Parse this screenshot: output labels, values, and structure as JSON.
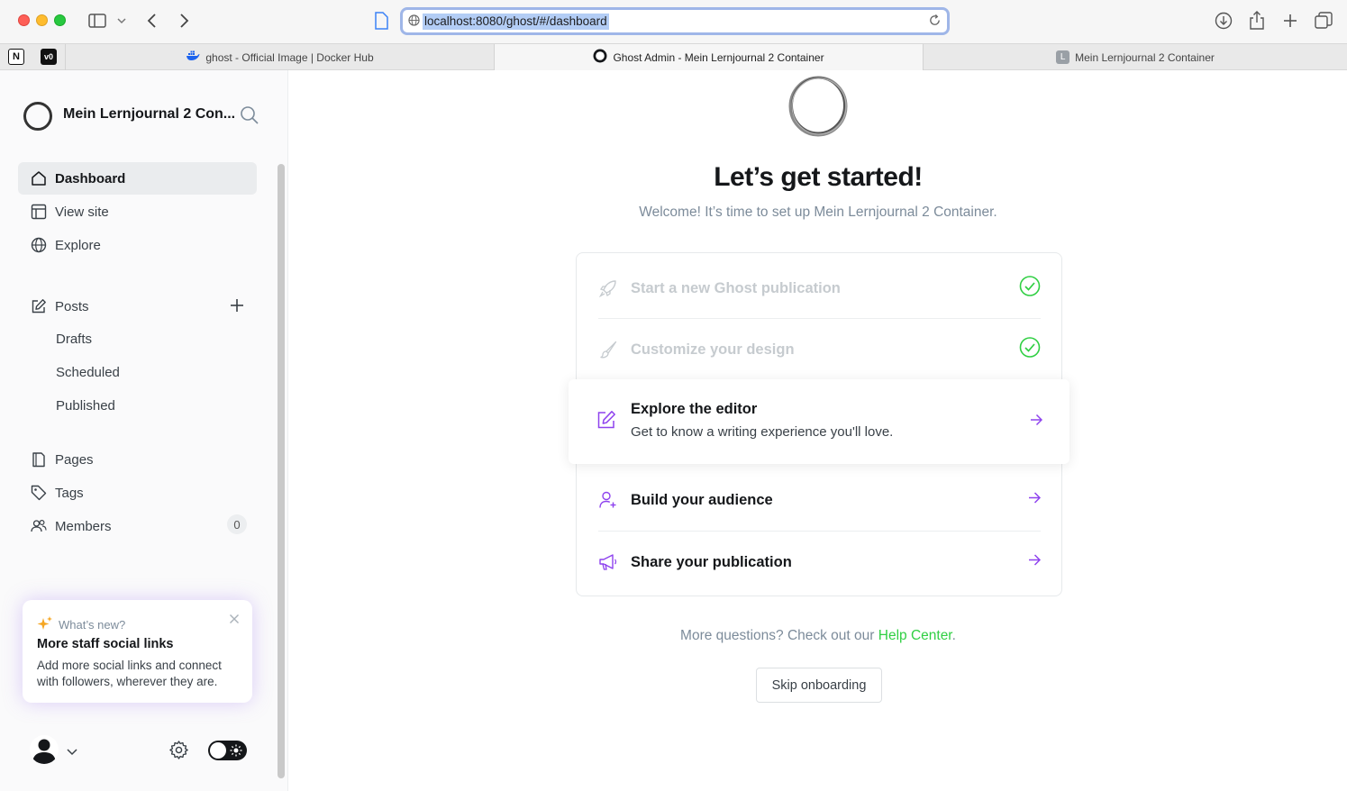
{
  "browser": {
    "url": "localhost:8080/ghost/#/dashboard",
    "tabs": [
      {
        "label": "ghost - Official Image | Docker Hub",
        "favicon": "docker-icon"
      },
      {
        "label": "Ghost Admin - Mein Lernjournal 2 Container",
        "favicon": "ghost-icon"
      },
      {
        "label": "Mein Lernjournal 2 Container",
        "favicon": "L"
      }
    ],
    "pinned": [
      {
        "name": "notion-icon",
        "glyph": "N"
      },
      {
        "name": "v0-icon",
        "glyph": "v0"
      }
    ]
  },
  "sidebar": {
    "site_title": "Mein Lernjournal 2 Con...",
    "nav": {
      "dashboard": "Dashboard",
      "view_site": "View site",
      "explore": "Explore",
      "posts": "Posts",
      "drafts": "Drafts",
      "scheduled": "Scheduled",
      "published": "Published",
      "pages": "Pages",
      "tags": "Tags",
      "members": "Members",
      "members_count": "0"
    },
    "whats_new": {
      "label": "What’s new?",
      "title": "More staff social links",
      "body": "Add more social links and connect with followers, wherever they are."
    }
  },
  "main": {
    "heading": "Let’s get started!",
    "welcome": "Welcome! It’s time to set up Mein Lernjournal 2 Container.",
    "steps": [
      {
        "title": "Start a new Ghost publication",
        "status": "done",
        "icon": "rocket-icon"
      },
      {
        "title": "Customize your design",
        "status": "done",
        "icon": "brush-icon"
      },
      {
        "title": "Explore the editor",
        "description": "Get to know a writing experience you'll love.",
        "status": "current",
        "icon": "edit-icon"
      },
      {
        "title": "Build your audience",
        "status": "todo",
        "icon": "user-add-icon"
      },
      {
        "title": "Share your publication",
        "status": "todo",
        "icon": "megaphone-icon"
      }
    ],
    "help_prefix": "More questions? Check out our",
    "help_link": "Help Center",
    "help_suffix": ".",
    "skip_label": "Skip onboarding"
  },
  "colors": {
    "accent_purple": "#8e42ee",
    "success_green": "#30cf43",
    "active_nav_bg": "#eaecee"
  }
}
